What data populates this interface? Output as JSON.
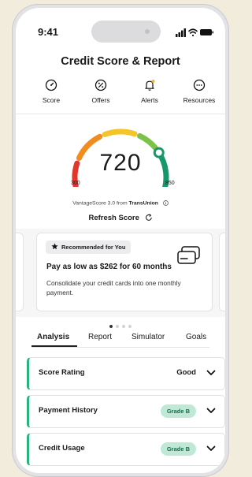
{
  "status_bar": {
    "time": "9:41"
  },
  "header": {
    "title": "Credit Score & Report"
  },
  "nav": {
    "items": [
      {
        "label": "Score",
        "icon": "score-icon"
      },
      {
        "label": "Offers",
        "icon": "percent-icon"
      },
      {
        "label": "Alerts",
        "icon": "bell-icon"
      },
      {
        "label": "Resources",
        "icon": "more-icon"
      }
    ]
  },
  "score": {
    "value": "720",
    "min": "300",
    "max": "850",
    "fraction": 0.76,
    "source_prefix": "VantageScore 3.0 from ",
    "source_bureau": "TransUnion",
    "refresh_label": "Refresh Score",
    "colors": {
      "poor": "#e0362c",
      "fair": "#f28c1c",
      "good": "#f4c528",
      "very_good": "#7cc24a",
      "excellent": "#15996a"
    }
  },
  "promo": {
    "badge": "Recommended for You",
    "headline": "Pay as low as $262 for 60 months",
    "description": "Consolidate your credit cards into one monthly payment.",
    "page_count": 4,
    "active_page": 1
  },
  "tabs": [
    {
      "label": "Analysis",
      "active": true
    },
    {
      "label": "Report",
      "active": false
    },
    {
      "label": "Simulator",
      "active": false
    },
    {
      "label": "Goals",
      "active": false
    }
  ],
  "factors": [
    {
      "label": "Score Rating",
      "value": "Good"
    },
    {
      "label": "Payment History",
      "grade": "Grade B"
    },
    {
      "label": "Credit Usage",
      "grade": "Grade B"
    }
  ],
  "colors": {
    "accent": "#2bb37e",
    "grade_bg": "#bfe9d6",
    "grade_text": "#1c6b4b"
  }
}
